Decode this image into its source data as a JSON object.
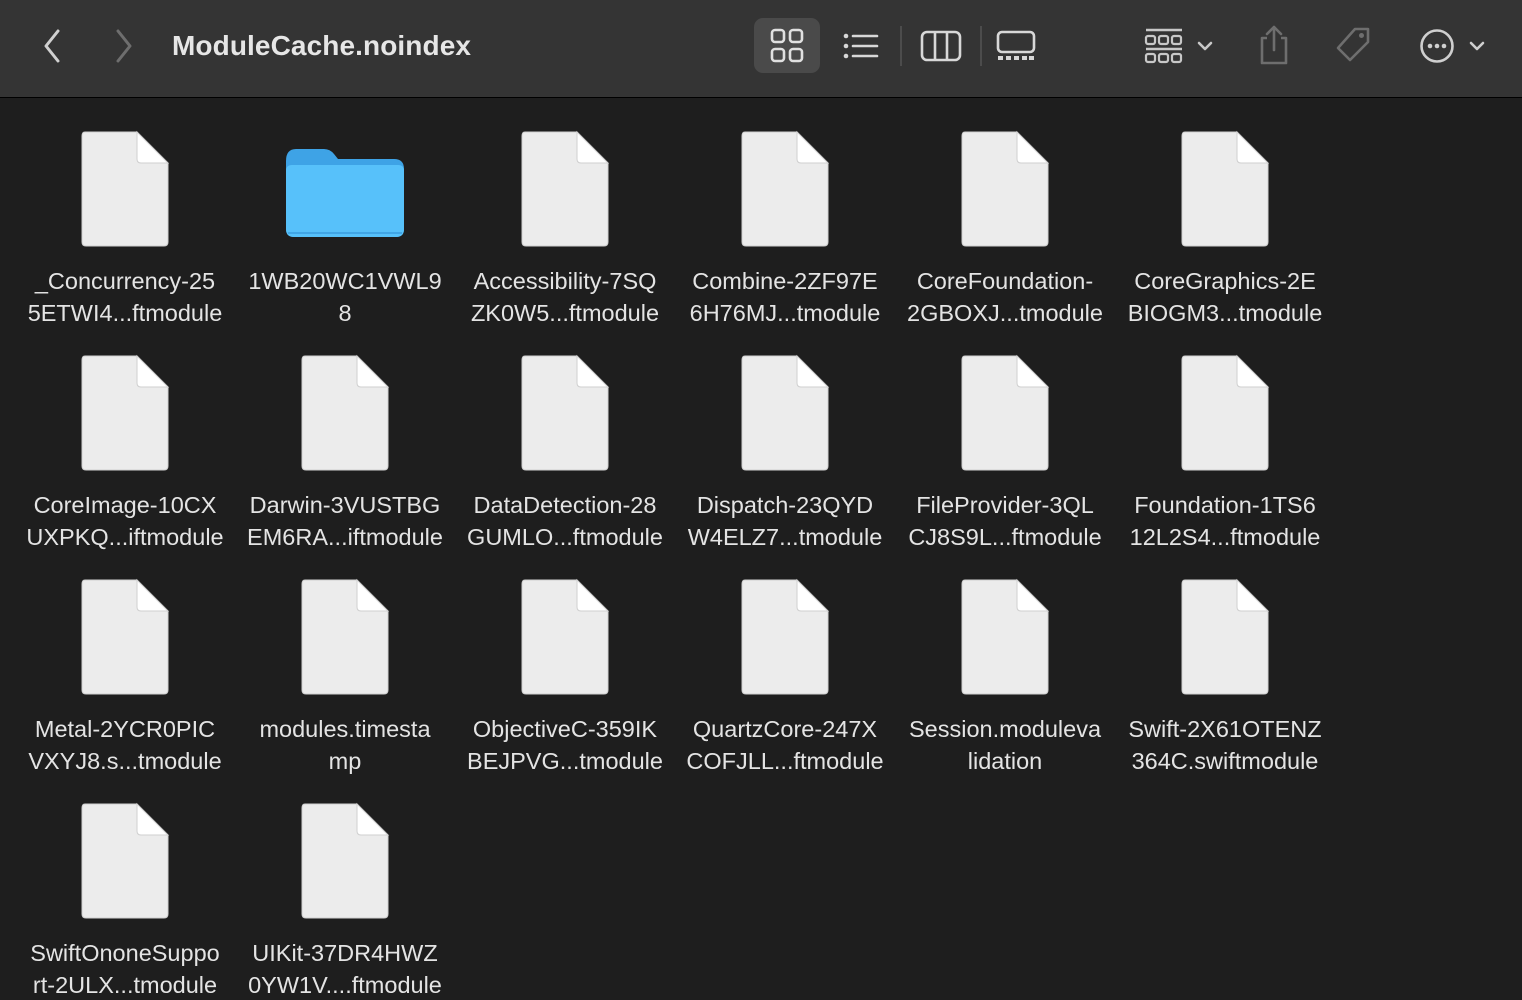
{
  "window": {
    "title": "ModuleCache.noindex"
  },
  "toolbar": {
    "back_icon": "chevron-left-icon",
    "forward_icon": "chevron-right-icon",
    "view_icons": [
      "icon-view-icon",
      "list-view-icon",
      "column-view-icon",
      "gallery-view-icon"
    ],
    "group_icon": "group-by-icon",
    "share_icon": "share-icon",
    "tag_icon": "tag-icon",
    "more_icon": "more-actions-icon",
    "selected_view": "icon-view"
  },
  "colors": {
    "background": "#1e1e1e",
    "toolbar": "#343434",
    "folder_blue": "#4fb8f5",
    "text": "#e4e4e4"
  },
  "files": [
    {
      "type": "file",
      "label_line1": "_Concurrency-25",
      "label_line2": "5ETWI4...ftmodule"
    },
    {
      "type": "folder",
      "label_line1": "1WB20WC1VWL9",
      "label_line2": "8"
    },
    {
      "type": "file",
      "label_line1": "Accessibility-7SQ",
      "label_line2": "ZK0W5...ftmodule"
    },
    {
      "type": "file",
      "label_line1": "Combine-2ZF97E",
      "label_line2": "6H76MJ...tmodule"
    },
    {
      "type": "file",
      "label_line1": "CoreFoundation-",
      "label_line2": "2GBOXJ...tmodule"
    },
    {
      "type": "file",
      "label_line1": "CoreGraphics-2E",
      "label_line2": "BIOGM3...tmodule"
    },
    {
      "type": "file",
      "label_line1": "CoreImage-10CX",
      "label_line2": "UXPKQ...iftmodule"
    },
    {
      "type": "file",
      "label_line1": "Darwin-3VUSTBG",
      "label_line2": "EM6RA...iftmodule"
    },
    {
      "type": "file",
      "label_line1": "DataDetection-28",
      "label_line2": "GUMLO...ftmodule"
    },
    {
      "type": "file",
      "label_line1": "Dispatch-23QYD",
      "label_line2": "W4ELZ7...tmodule"
    },
    {
      "type": "file",
      "label_line1": "FileProvider-3QL",
      "label_line2": "CJ8S9L...ftmodule"
    },
    {
      "type": "file",
      "label_line1": "Foundation-1TS6",
      "label_line2": "12L2S4...ftmodule"
    },
    {
      "type": "file",
      "label_line1": "Metal-2YCR0PIC",
      "label_line2": "VXYJ8.s...tmodule"
    },
    {
      "type": "file",
      "label_line1": "modules.timesta",
      "label_line2": "mp"
    },
    {
      "type": "file",
      "label_line1": "ObjectiveC-359IK",
      "label_line2": "BEJPVG...tmodule"
    },
    {
      "type": "file",
      "label_line1": "QuartzCore-247X",
      "label_line2": "COFJLL...ftmodule"
    },
    {
      "type": "file",
      "label_line1": "Session.moduleva",
      "label_line2": "lidation"
    },
    {
      "type": "file",
      "label_line1": "Swift-2X61OTENZ",
      "label_line2": "364C.swiftmodule"
    },
    {
      "type": "file",
      "label_line1": "SwiftOnoneSuppo",
      "label_line2": "rt-2ULX...tmodule"
    },
    {
      "type": "file",
      "label_line1": "UIKit-37DR4HWZ",
      "label_line2": "0YW1V....ftmodule"
    }
  ]
}
